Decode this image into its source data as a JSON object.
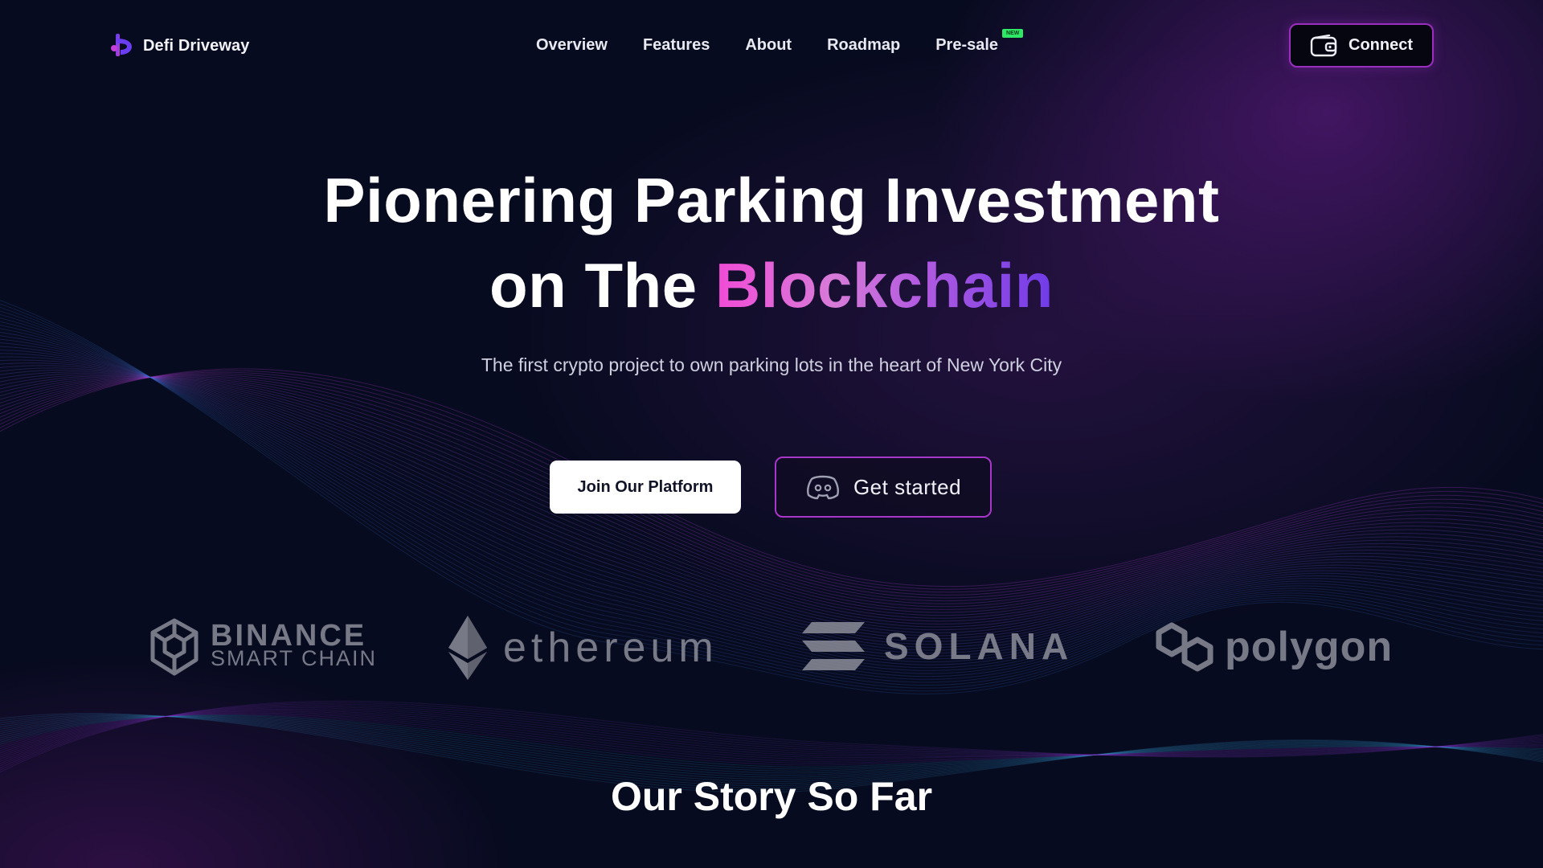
{
  "nav": {
    "brand": "Defi Driveway",
    "links": [
      "Overview",
      "Features",
      "About",
      "Roadmap",
      "Pre-sale"
    ],
    "new_badge": "NEW",
    "connect_label": "Connect"
  },
  "hero": {
    "title_line1": "Pionering Parking Investment",
    "title_line2_prefix": "on The ",
    "title_line2_highlight": "Blockchain",
    "subtitle": "The first crypto project to own parking lots in the heart of New York City",
    "primary_button": "Join Our Platform",
    "secondary_button": "Get started"
  },
  "partners": {
    "binance_top": "BINANCE",
    "binance_bottom": "SMART CHAIN",
    "ethereum": "ethereum",
    "solana": "SOLANA",
    "polygon": "polygon"
  },
  "story": {
    "title": "Our Story So Far"
  },
  "colors": {
    "background": "#070b1f",
    "accent_purple": "#a836c8",
    "gradient_pink": "#f04bd6",
    "gradient_violet": "#6f3be8",
    "badge_green": "#2ee866"
  },
  "icons": {
    "brand": "defi-driveway-logo",
    "connect": "wallet-icon",
    "get_started": "discord-icon"
  }
}
